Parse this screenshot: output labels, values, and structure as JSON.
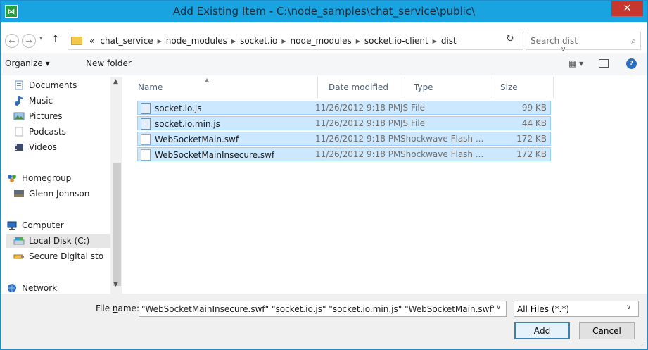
{
  "window": {
    "title": "Add Existing Item - C:\\node_samples\\chat_service\\public\\",
    "close_glyph": "✕",
    "app_icon_glyph": "⋈"
  },
  "address": {
    "overflow": "«",
    "crumbs": [
      "chat_service",
      "node_modules",
      "socket.io",
      "node_modules",
      "socket.io-client",
      "dist"
    ],
    "search_placeholder": "Search dist"
  },
  "toolbar": {
    "organize": "Organize ▾",
    "new_folder": "New folder",
    "view_glyph": "▦ ▾",
    "help_glyph": "?"
  },
  "nav": {
    "items": [
      {
        "label": "Documents",
        "icon": "documents-icon"
      },
      {
        "label": "Music",
        "icon": "music-icon"
      },
      {
        "label": "Pictures",
        "icon": "pictures-icon"
      },
      {
        "label": "Podcasts",
        "icon": "podcasts-icon"
      },
      {
        "label": "Videos",
        "icon": "videos-icon"
      },
      {
        "label": "Homegroup",
        "icon": "homegroup-icon"
      },
      {
        "label": "Glenn Johnson",
        "icon": "user-icon"
      },
      {
        "label": "Computer",
        "icon": "computer-icon"
      },
      {
        "label": "Local Disk (C:)",
        "icon": "disk-icon"
      },
      {
        "label": "Secure Digital sto",
        "icon": "sd-card-icon"
      },
      {
        "label": "Network",
        "icon": "network-icon"
      }
    ]
  },
  "columns": {
    "name": "Name",
    "date": "Date modified",
    "type": "Type",
    "size": "Size"
  },
  "files": [
    {
      "name": "socket.io.js",
      "date": "11/26/2012 9:18 PM",
      "type": "JS File",
      "size": "99 KB"
    },
    {
      "name": "socket.io.min.js",
      "date": "11/26/2012 9:18 PM",
      "type": "JS File",
      "size": "44 KB"
    },
    {
      "name": "WebSocketMain.swf",
      "date": "11/26/2012 9:18 PM",
      "type": "Shockwave Flash ...",
      "size": "172 KB"
    },
    {
      "name": "WebSocketMainInsecure.swf",
      "date": "11/26/2012 9:18 PM",
      "type": "Shockwave Flash ...",
      "size": "172 KB"
    }
  ],
  "footer": {
    "file_name_label_prefix": "File ",
    "file_name_label_accel": "n",
    "file_name_label_suffix": "ame:",
    "file_name_value": "\"WebSocketMainInsecure.swf\" \"socket.io.js\" \"socket.io.min.js\" \"WebSocketMain.swf\"",
    "filter": "All Files (*.*)",
    "add_accel": "A",
    "add_rest": "dd",
    "cancel": "Cancel"
  }
}
